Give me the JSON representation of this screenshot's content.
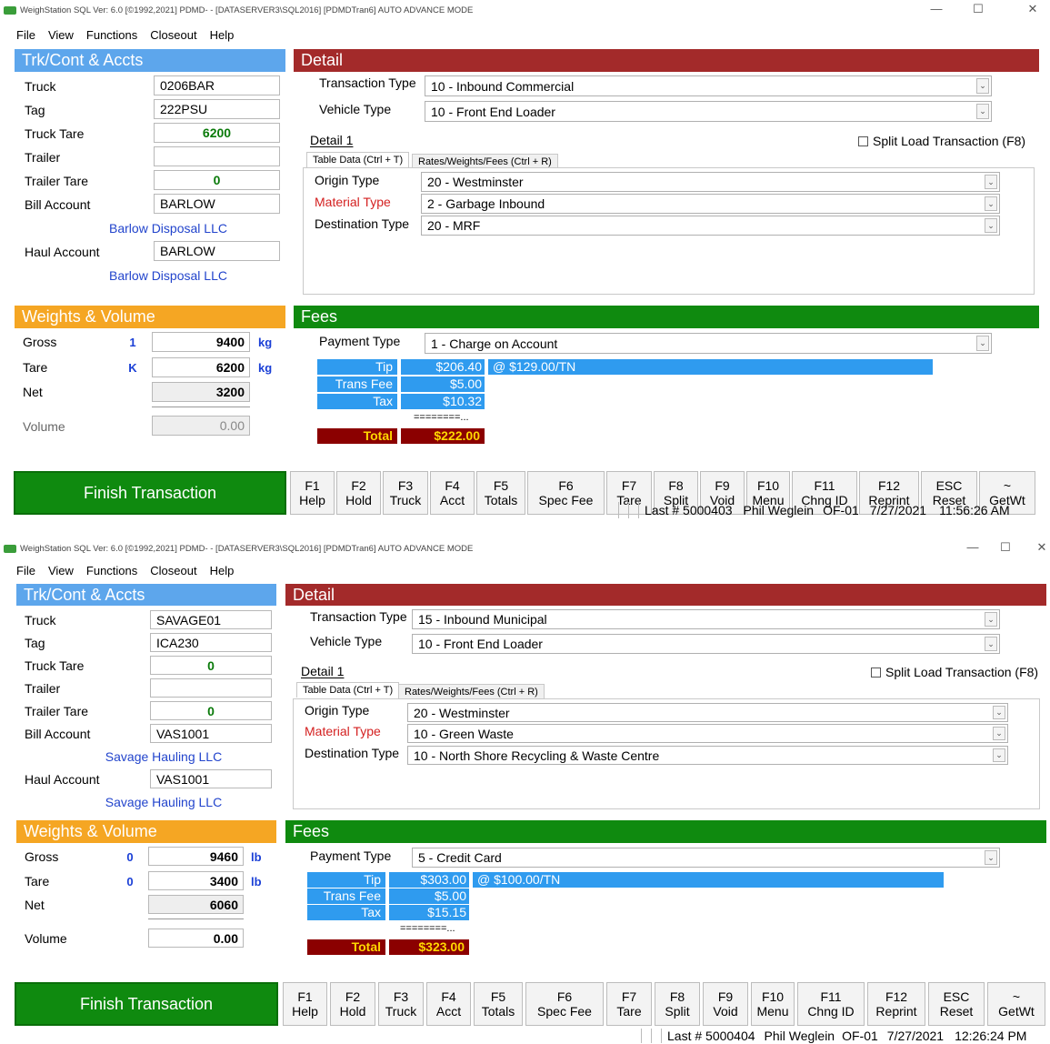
{
  "windows": [
    {
      "title": "WeighStation SQL  Ver: 6.0 [©1992,2021]  PDMD- - [DATASERVER3\\SQL2016] [PDMDTran6] AUTO ADVANCE MODE",
      "menu": [
        "File",
        "View",
        "Functions",
        "Closeout",
        "Help"
      ],
      "sections": {
        "trk": "Trk/Cont & Accts",
        "detail": "Detail",
        "weights": "Weights & Volume",
        "fees": "Fees"
      },
      "trk": {
        "truck_label": "Truck",
        "truck": "0206BAR",
        "tag_label": "Tag",
        "tag": "222PSU",
        "truck_tare_label": "Truck Tare",
        "truck_tare": "6200",
        "trailer_label": "Trailer",
        "trailer": "",
        "trailer_tare_label": "Trailer Tare",
        "trailer_tare": "0",
        "bill_label": "Bill Account",
        "bill": "BARLOW",
        "bill_name": "Barlow Disposal LLC",
        "haul_label": "Haul Account",
        "haul": "BARLOW",
        "haul_name": "Barlow Disposal LLC"
      },
      "detail": {
        "transaction_type_label": "Transaction Type",
        "transaction_type": "10 - Inbound Commercial",
        "vehicle_type_label": "Vehicle Type",
        "vehicle_type": "10 - Front End Loader",
        "detail_tab": "Detail 1",
        "split_label": "Split Load Transaction (F8)",
        "tab_table": "Table Data (Ctrl + T)",
        "tab_rates": "Rates/Weights/Fees (Ctrl + R)",
        "origin_label": "Origin Type",
        "origin": "20 - Westminster",
        "material_label": "Material Type",
        "material": "2 - Garbage Inbound",
        "dest_label": "Destination Type",
        "dest": "20 - MRF"
      },
      "weights": {
        "gross_label": "Gross",
        "gross_ind": "1",
        "gross": "9400",
        "gross_unit": "kg",
        "tare_label": "Tare",
        "tare_ind": "K",
        "tare": "6200",
        "tare_unit": "kg",
        "net_label": "Net",
        "net": "3200",
        "volume_label": "Volume",
        "volume": "0.00"
      },
      "fees": {
        "payment_label": "Payment Type",
        "payment": "1 - Charge on Account",
        "tip_label": "Tip",
        "tip": "$206.40",
        "tip_rate": "@ $129.00/TN",
        "trans_label": "Trans Fee",
        "trans": "$5.00",
        "tax_label": "Tax",
        "tax": "$10.32",
        "eq": "========...",
        "total_label": "Total",
        "total": "$222.00"
      },
      "finish": "Finish Transaction",
      "fkeys": [
        {
          "k": "F1",
          "l": "Help"
        },
        {
          "k": "F2",
          "l": "Hold"
        },
        {
          "k": "F3",
          "l": "Truck"
        },
        {
          "k": "F4",
          "l": "Acct"
        },
        {
          "k": "F5",
          "l": "Totals"
        },
        {
          "k": "F6",
          "l": "Spec Fee"
        },
        {
          "k": "F7",
          "l": "Tare"
        },
        {
          "k": "F8",
          "l": "Split"
        },
        {
          "k": "F9",
          "l": "Void"
        },
        {
          "k": "F10",
          "l": "Menu"
        },
        {
          "k": "F11",
          "l": "Chng ID"
        },
        {
          "k": "F12",
          "l": "Reprint"
        },
        {
          "k": "ESC",
          "l": "Reset"
        },
        {
          "k": "~",
          "l": "GetWt"
        }
      ],
      "status": {
        "last": "Last # 5000403",
        "user": "Phil Weglein",
        "station": "OF-01",
        "date": "7/27/2021",
        "time": "11:56:26 AM"
      },
      "window_controls": {
        "min": "—",
        "max": "☐",
        "close": "✕"
      }
    },
    {
      "title": "WeighStation  SQL  Ver: 6.0 [©1992,2021]  PDMD- - [DATASERVER3\\SQL2016] [PDMDTran6] AUTO ADVANCE MODE",
      "menu": [
        "File",
        "View",
        "Functions",
        "Closeout",
        "Help"
      ],
      "sections": {
        "trk": "Trk/Cont & Accts",
        "detail": "Detail",
        "weights": "Weights & Volume",
        "fees": "Fees"
      },
      "trk": {
        "truck_label": "Truck",
        "truck": "SAVAGE01",
        "tag_label": "Tag",
        "tag": "ICA230",
        "truck_tare_label": "Truck Tare",
        "truck_tare": "0",
        "trailer_label": "Trailer",
        "trailer": "",
        "trailer_tare_label": "Trailer Tare",
        "trailer_tare": "0",
        "bill_label": "Bill Account",
        "bill": "VAS1001",
        "bill_name": "Savage Hauling LLC",
        "haul_label": "Haul Account",
        "haul": "VAS1001",
        "haul_name": "Savage Hauling LLC"
      },
      "detail": {
        "transaction_type_label": "Transaction Type",
        "transaction_type": "15 - Inbound Municipal",
        "vehicle_type_label": "Vehicle Type",
        "vehicle_type": "10 - Front End Loader",
        "detail_tab": "Detail 1",
        "split_label": "Split Load Transaction (F8)",
        "tab_table": "Table Data (Ctrl + T)",
        "tab_rates": "Rates/Weights/Fees (Ctrl + R)",
        "origin_label": "Origin Type",
        "origin": "20 - Westminster",
        "material_label": "Material Type",
        "material": "10 - Green Waste",
        "dest_label": "Destination Type",
        "dest": "10 - North Shore Recycling & Waste Centre"
      },
      "weights": {
        "gross_label": "Gross",
        "gross_ind": "0",
        "gross": "9460",
        "gross_unit": "lb",
        "tare_label": "Tare",
        "tare_ind": "0",
        "tare": "3400",
        "tare_unit": "lb",
        "net_label": "Net",
        "net": "6060",
        "volume_label": "Volume",
        "volume": "0.00"
      },
      "fees": {
        "payment_label": "Payment Type",
        "payment": "5 - Credit Card",
        "tip_label": "Tip",
        "tip": "$303.00",
        "tip_rate": "@ $100.00/TN",
        "trans_label": "Trans Fee",
        "trans": "$5.00",
        "tax_label": "Tax",
        "tax": "$15.15",
        "eq": "========...",
        "total_label": "Total",
        "total": "$323.00"
      },
      "finish": "Finish Transaction",
      "fkeys": [
        {
          "k": "F1",
          "l": "Help"
        },
        {
          "k": "F2",
          "l": "Hold"
        },
        {
          "k": "F3",
          "l": "Truck"
        },
        {
          "k": "F4",
          "l": "Acct"
        },
        {
          "k": "F5",
          "l": "Totals"
        },
        {
          "k": "F6",
          "l": "Spec Fee"
        },
        {
          "k": "F7",
          "l": "Tare"
        },
        {
          "k": "F8",
          "l": "Split"
        },
        {
          "k": "F9",
          "l": "Void"
        },
        {
          "k": "F10",
          "l": "Menu"
        },
        {
          "k": "F11",
          "l": "Chng ID"
        },
        {
          "k": "F12",
          "l": "Reprint"
        },
        {
          "k": "ESC",
          "l": "Reset"
        },
        {
          "k": "~",
          "l": "GetWt"
        }
      ],
      "status": {
        "last": "Last # 5000404",
        "user": "Phil Weglein",
        "station": "OF-01",
        "date": "7/27/2021",
        "time": "12:26:24 PM"
      },
      "window_controls": {
        "min": "—",
        "max": "☐",
        "close": "✕"
      }
    }
  ]
}
